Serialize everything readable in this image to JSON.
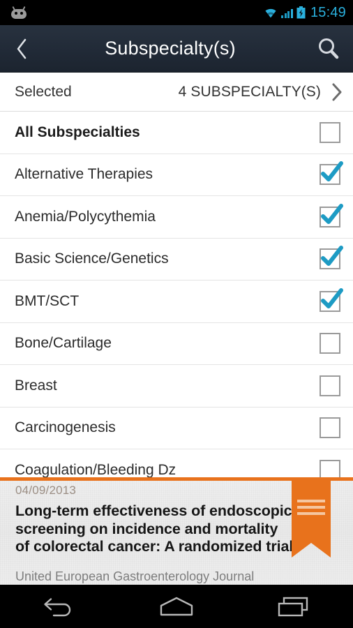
{
  "status_bar": {
    "notification_icon": "android-jellybean-face-icon",
    "wifi_icon": "wifi-icon",
    "signal_icon": "cellular-signal-icon",
    "battery_icon": "battery-charging-icon",
    "time": "15:49",
    "accent_color": "#2ab0dd"
  },
  "action_bar": {
    "back_icon": "back-chevron-icon",
    "title": "Subspecialty(s)",
    "search_icon": "search-icon",
    "background_color": "#242f3e"
  },
  "selected_row": {
    "label": "Selected",
    "value": "4 SUBSPECIALTY(S)",
    "chevron_icon": "chevron-right-icon"
  },
  "list": {
    "items": [
      {
        "label": "All Subspecialties",
        "checked": false,
        "bold": true
      },
      {
        "label": "Alternative Therapies",
        "checked": true,
        "bold": false
      },
      {
        "label": "Anemia/Polycythemia",
        "checked": true,
        "bold": false
      },
      {
        "label": "Basic Science/Genetics",
        "checked": true,
        "bold": false
      },
      {
        "label": "BMT/SCT",
        "checked": true,
        "bold": false
      },
      {
        "label": "Bone/Cartilage",
        "checked": false,
        "bold": false
      },
      {
        "label": "Breast",
        "checked": false,
        "bold": false
      },
      {
        "label": "Carcinogenesis",
        "checked": false,
        "bold": false
      },
      {
        "label": "Coagulation/Bleeding Dz",
        "checked": false,
        "bold": false
      }
    ],
    "checkbox_checked_color": "#1d9bc4",
    "checkbox_border_color": "#9a9a9a"
  },
  "banner": {
    "date": "04/09/2013",
    "title": "Long-term effectiveness of endoscopic screening on incidence and mortality of colorectal cancer: A randomized trial",
    "journal": "United European Gastroenterology Journal",
    "ribbon_icon": "bookmark-ribbon-icon",
    "accent_color": "#e8721c"
  },
  "nav_bar": {
    "back_icon": "nav-back-icon",
    "home_icon": "nav-home-icon",
    "recents_icon": "nav-recents-icon"
  }
}
